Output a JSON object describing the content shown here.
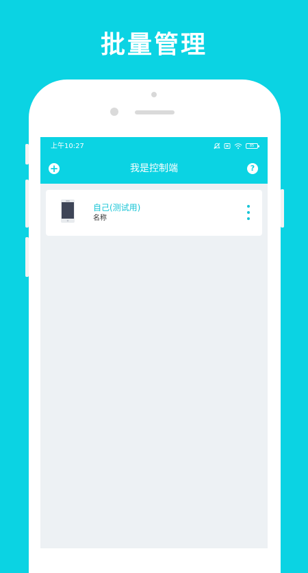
{
  "promo": {
    "title": "批量管理"
  },
  "status_bar": {
    "time": "上午10:27",
    "battery": "85"
  },
  "header": {
    "title": "我是控制端",
    "add_icon": "plus-circle-icon",
    "help_icon": "question-circle-icon",
    "add_glyph": "+",
    "help_glyph": "?"
  },
  "devices": [
    {
      "name": "自己(测试用)",
      "subtitle": "名称",
      "icon": "phone-icon",
      "menu_icon": "more-vertical-icon"
    }
  ],
  "colors": {
    "accent": "#0BD3E3",
    "accent_text": "#16C4D6",
    "screen_bg": "#EDF1F4",
    "card_bg": "#FFFFFF"
  }
}
